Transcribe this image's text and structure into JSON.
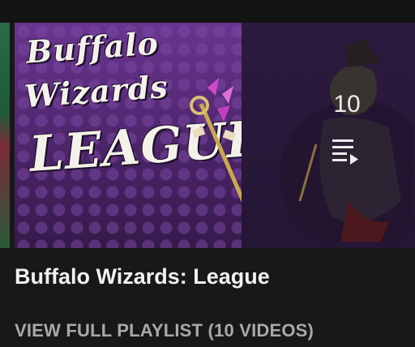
{
  "playlist": {
    "thumbnail_art_lines": [
      "Buffalo",
      "Wizards",
      "League"
    ],
    "video_count": "10",
    "title": "Buffalo Wizards: League",
    "view_full_label": "VIEW FULL PLAYLIST (10 VIDEOS)",
    "queue_icon": "playlist-play-icon"
  },
  "colors": {
    "background": "#181818",
    "title_text": "#f1f1f1",
    "secondary_text": "#a9a9a9",
    "thumbnail_purple": "#5a2d7a"
  }
}
